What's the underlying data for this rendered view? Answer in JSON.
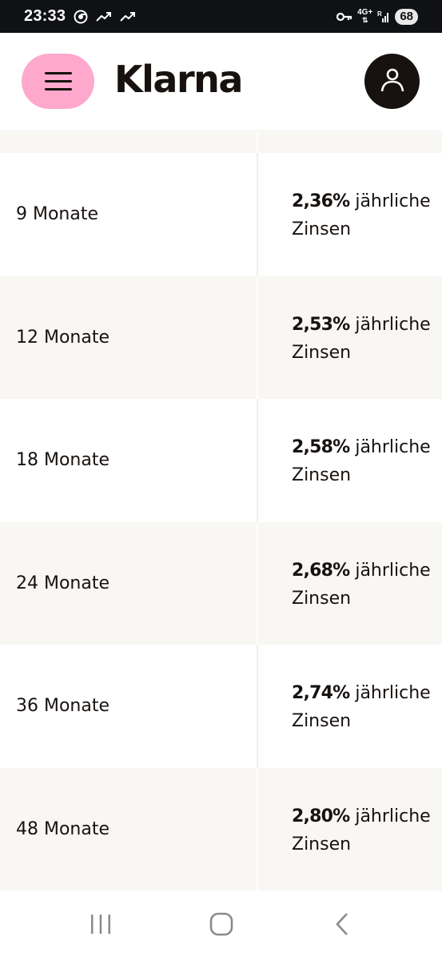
{
  "status_bar": {
    "time": "23:33",
    "network": "4G+",
    "roaming": "R",
    "battery": "68"
  },
  "header": {
    "logo": "Klarna",
    "menu_icon": "hamburger-icon",
    "account_icon": "user-icon",
    "accent_color": "#ffa8cd"
  },
  "rates": [
    {
      "term": "9 Monate",
      "rate": "2,36%",
      "label": "jährliche Zinsen"
    },
    {
      "term": "12 Monate",
      "rate": "2,53%",
      "label": "jährliche Zinsen"
    },
    {
      "term": "18 Monate",
      "rate": "2,58%",
      "label": "jährliche Zinsen"
    },
    {
      "term": "24 Monate",
      "rate": "2,68%",
      "label": "jährliche Zinsen"
    },
    {
      "term": "36 Monate",
      "rate": "2,74%",
      "label": "jährliche Zinsen"
    },
    {
      "term": "48 Monate",
      "rate": "2,80%",
      "label": "jährliche Zinsen"
    }
  ],
  "nav_bar": {
    "recent_icon": "recent-apps-icon",
    "home_icon": "home-icon",
    "back_icon": "back-icon"
  }
}
